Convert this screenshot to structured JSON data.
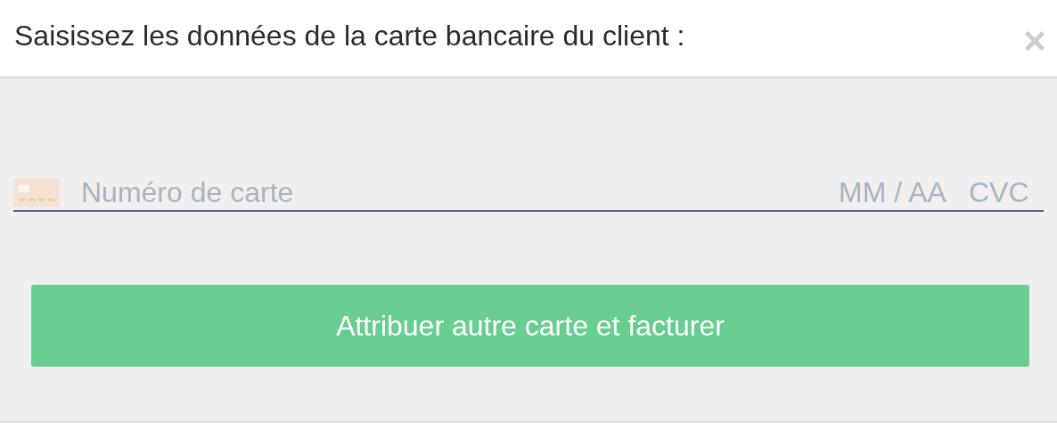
{
  "dialog": {
    "title": "Saisissez les données de la carte bancaire du client :",
    "close": "×"
  },
  "card_form": {
    "number": {
      "placeholder": "Numéro de carte"
    },
    "expiry": {
      "placeholder": "MM / AA"
    },
    "cvc": {
      "placeholder": "CVC"
    }
  },
  "submit_button": {
    "label": "Attribuer autre carte et facturer"
  }
}
